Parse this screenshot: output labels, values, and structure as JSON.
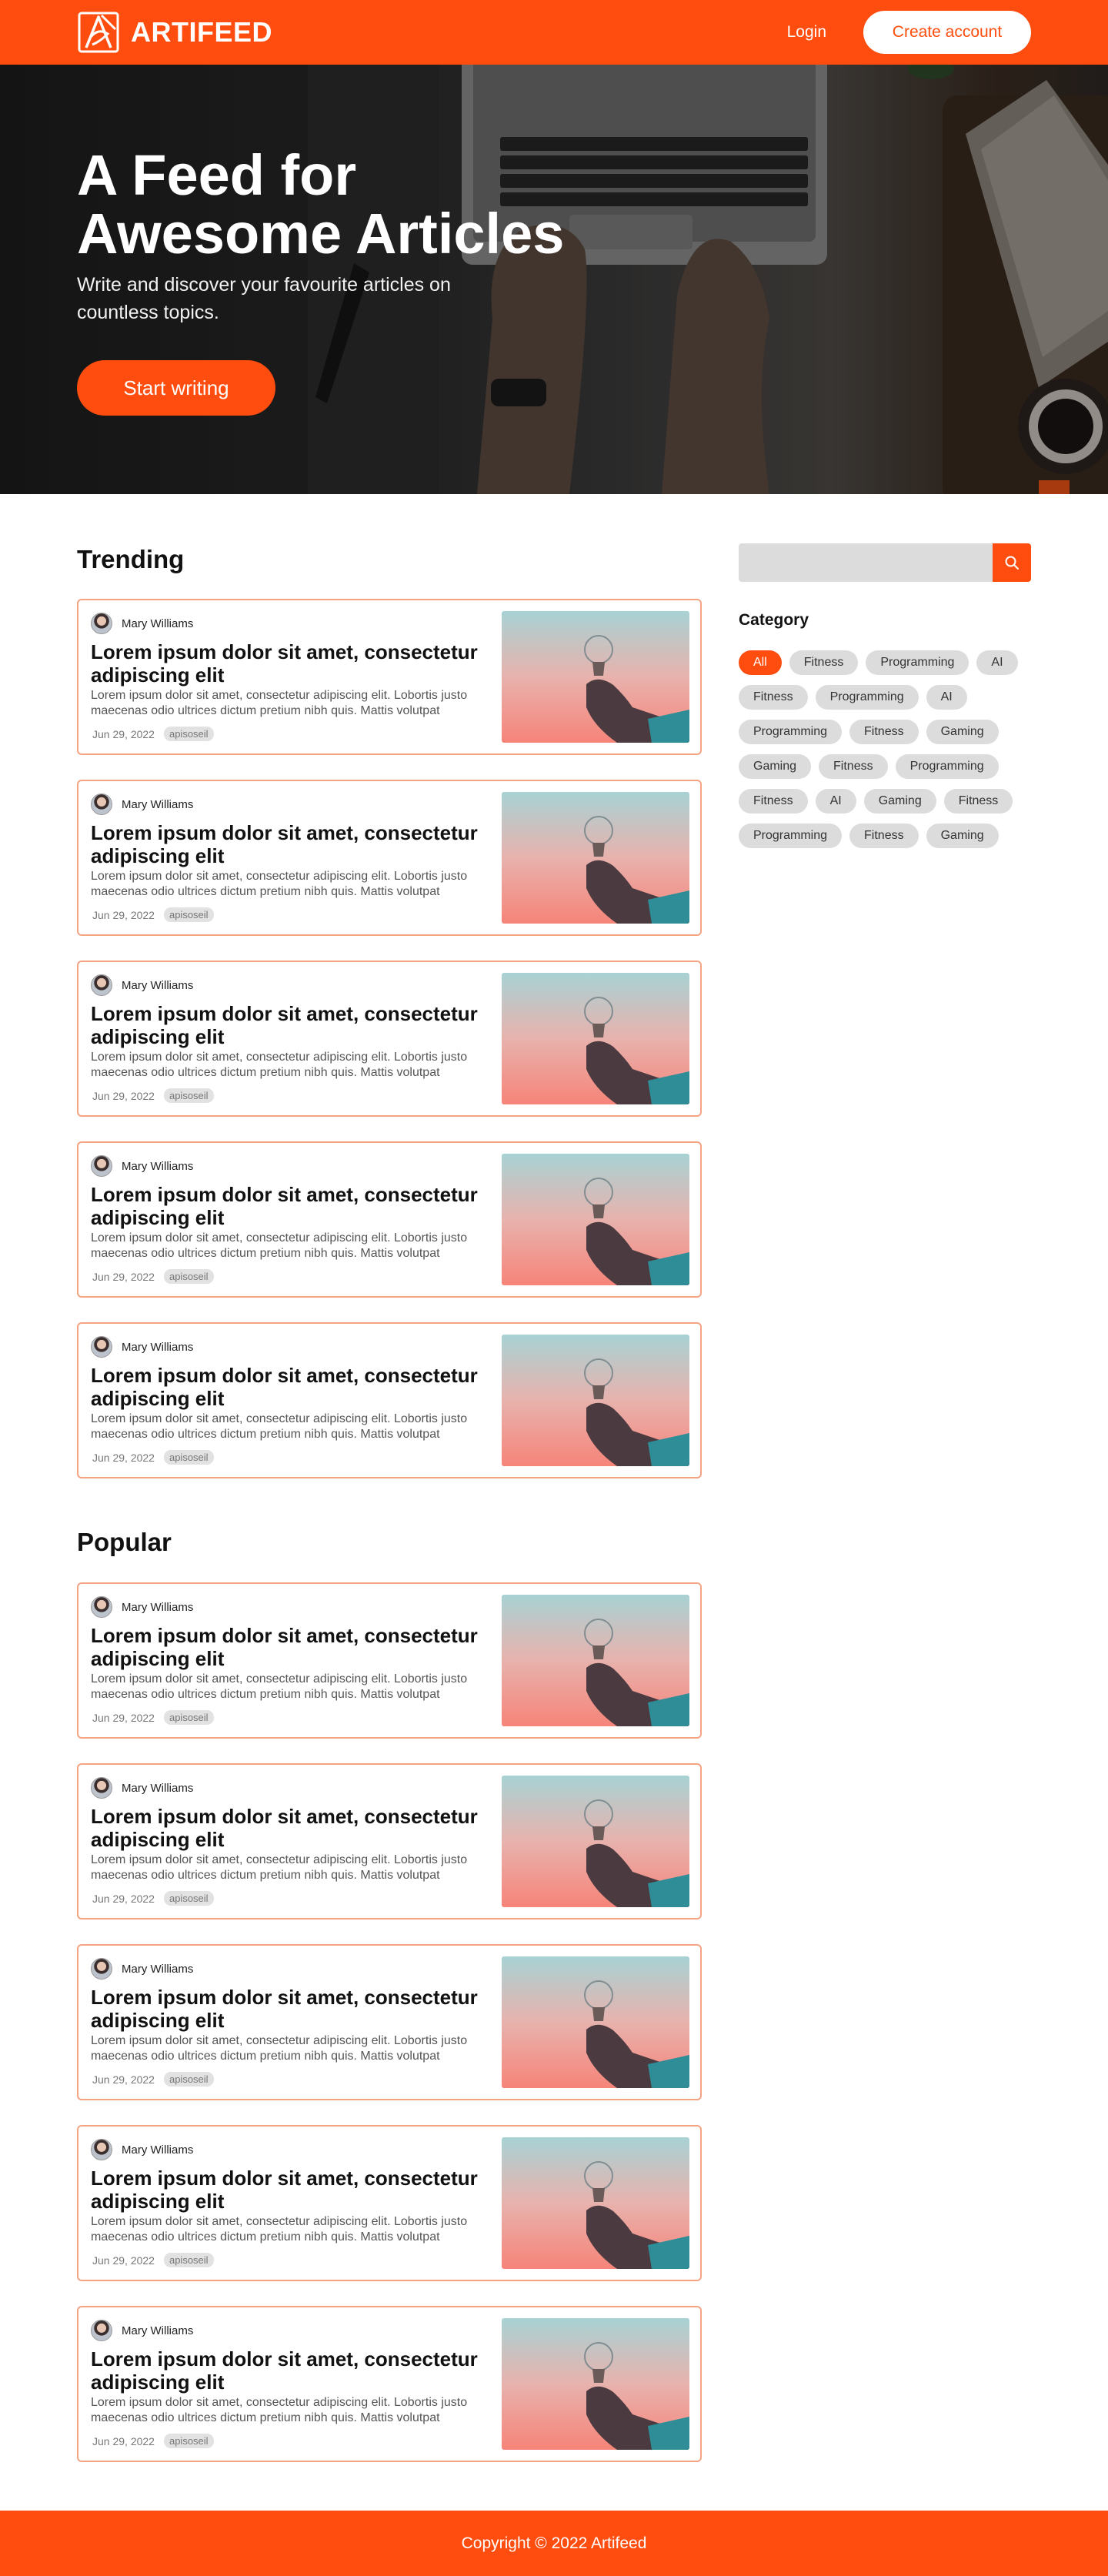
{
  "header": {
    "logo_text": "ARTIFEED",
    "login_label": "Login",
    "create_account_label": "Create account"
  },
  "hero": {
    "title_line1": "A Feed for",
    "title_line2": "Awesome Articles",
    "subtitle": "Write and discover your favourite articles on countless topics.",
    "cta_label": "Start writing"
  },
  "trending": {
    "title": "Trending",
    "articles": [
      {
        "author": "Mary Williams",
        "title": "Lorem ipsum dolor sit amet, consectetur adipiscing elit",
        "excerpt": "Lorem ipsum dolor sit amet, consectetur adipiscing elit. Lobortis justo maecenas odio ultrices dictum pretium nibh quis. Mattis volutpat",
        "date": "Jun 29, 2022",
        "tag": "apisoseil"
      },
      {
        "author": "Mary Williams",
        "title": "Lorem ipsum dolor sit amet, consectetur adipiscing elit",
        "excerpt": "Lorem ipsum dolor sit amet, consectetur adipiscing elit. Lobortis justo maecenas odio ultrices dictum pretium nibh quis. Mattis volutpat",
        "date": "Jun 29, 2022",
        "tag": "apisoseil"
      },
      {
        "author": "Mary Williams",
        "title": "Lorem ipsum dolor sit amet, consectetur adipiscing elit",
        "excerpt": "Lorem ipsum dolor sit amet, consectetur adipiscing elit. Lobortis justo maecenas odio ultrices dictum pretium nibh quis. Mattis volutpat",
        "date": "Jun 29, 2022",
        "tag": "apisoseil"
      },
      {
        "author": "Mary Williams",
        "title": "Lorem ipsum dolor sit amet, consectetur adipiscing elit",
        "excerpt": "Lorem ipsum dolor sit amet, consectetur adipiscing elit. Lobortis justo maecenas odio ultrices dictum pretium nibh quis. Mattis volutpat",
        "date": "Jun 29, 2022",
        "tag": "apisoseil"
      },
      {
        "author": "Mary Williams",
        "title": "Lorem ipsum dolor sit amet, consectetur adipiscing elit",
        "excerpt": "Lorem ipsum dolor sit amet, consectetur adipiscing elit. Lobortis justo maecenas odio ultrices dictum pretium nibh quis. Mattis volutpat",
        "date": "Jun 29, 2022",
        "tag": "apisoseil"
      }
    ]
  },
  "popular": {
    "title": "Popular",
    "articles": [
      {
        "author": "Mary Williams",
        "title": "Lorem ipsum dolor sit amet, consectetur adipiscing elit",
        "excerpt": "Lorem ipsum dolor sit amet, consectetur adipiscing elit. Lobortis justo maecenas odio ultrices dictum pretium nibh quis. Mattis volutpat",
        "date": "Jun 29, 2022",
        "tag": "apisoseil"
      },
      {
        "author": "Mary Williams",
        "title": "Lorem ipsum dolor sit amet, consectetur adipiscing elit",
        "excerpt": "Lorem ipsum dolor sit amet, consectetur adipiscing elit. Lobortis justo maecenas odio ultrices dictum pretium nibh quis. Mattis volutpat",
        "date": "Jun 29, 2022",
        "tag": "apisoseil"
      },
      {
        "author": "Mary Williams",
        "title": "Lorem ipsum dolor sit amet, consectetur adipiscing elit",
        "excerpt": "Lorem ipsum dolor sit amet, consectetur adipiscing elit. Lobortis justo maecenas odio ultrices dictum pretium nibh quis. Mattis volutpat",
        "date": "Jun 29, 2022",
        "tag": "apisoseil"
      },
      {
        "author": "Mary Williams",
        "title": "Lorem ipsum dolor sit amet, consectetur adipiscing elit",
        "excerpt": "Lorem ipsum dolor sit amet, consectetur adipiscing elit. Lobortis justo maecenas odio ultrices dictum pretium nibh quis. Mattis volutpat",
        "date": "Jun 29, 2022",
        "tag": "apisoseil"
      },
      {
        "author": "Mary Williams",
        "title": "Lorem ipsum dolor sit amet, consectetur adipiscing elit",
        "excerpt": "Lorem ipsum dolor sit amet, consectetur adipiscing elit. Lobortis justo maecenas odio ultrices dictum pretium nibh quis. Mattis volutpat",
        "date": "Jun 29, 2022",
        "tag": "apisoseil"
      }
    ]
  },
  "sidebar": {
    "search_placeholder": "",
    "search_icon": "search-icon",
    "category_title": "Category",
    "categories": [
      "All",
      "Fitness",
      "Programming",
      "AI",
      "Fitness",
      "Programming",
      "AI",
      "Programming",
      "Fitness",
      "Gaming",
      "Gaming",
      "Fitness",
      "Programming",
      "Fitness",
      "AI",
      "Gaming",
      "Fitness",
      "Programming",
      "Fitness",
      "Gaming"
    ],
    "active_category_index": 0
  },
  "footer": {
    "copyright": "Copyright © 2022 Artifeed"
  },
  "colors": {
    "accent": "#fe4d0e",
    "card_border": "#f4a383",
    "chip_bg": "#dcdcdc"
  }
}
